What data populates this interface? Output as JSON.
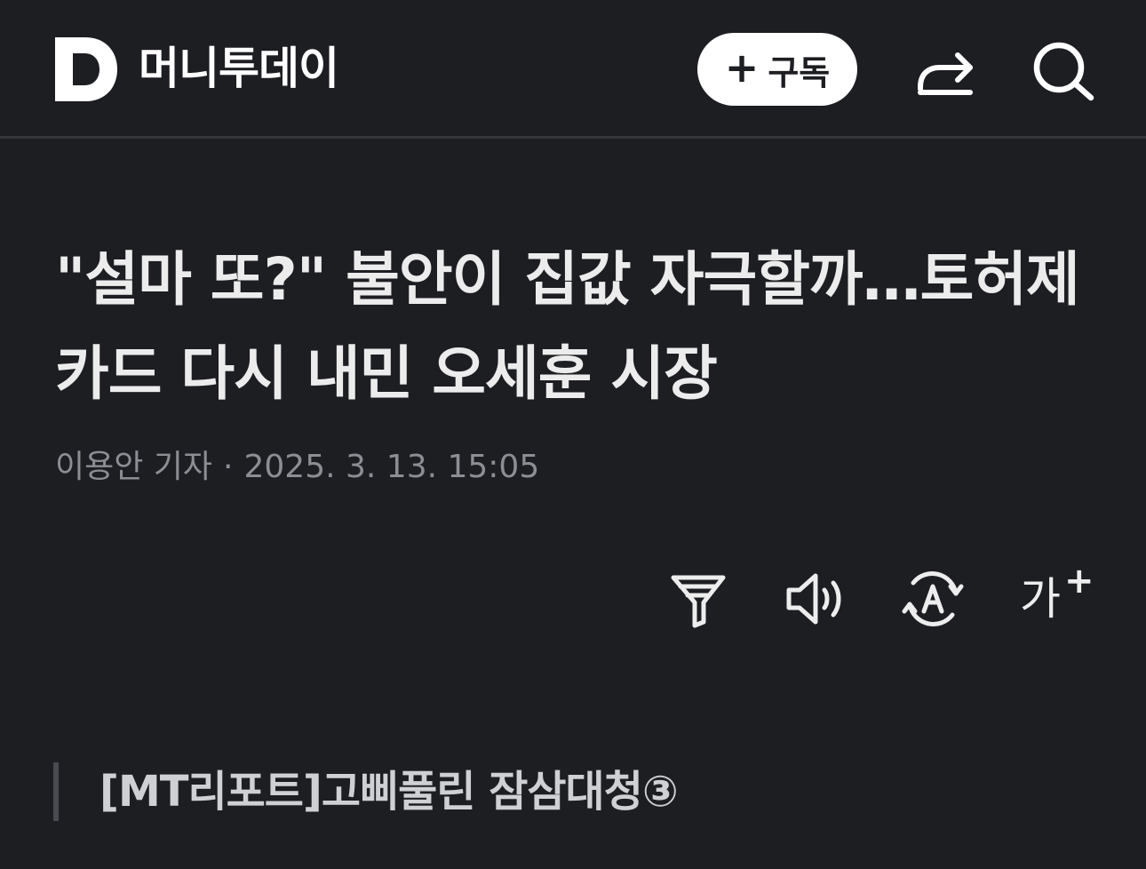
{
  "header": {
    "logo_letter": "D",
    "brand_name": "머니투데이",
    "subscribe_plus": "+",
    "subscribe_label": "구독"
  },
  "article": {
    "headline": "\"설마 또?\" 불안이 집값 자극할까…토허제 카드 다시 내민 오세훈 시장",
    "author": "이용안 기자",
    "separator": "·",
    "date": "2025. 3. 13. 15:05"
  },
  "tools": {
    "font_size_label": "가",
    "font_size_plus": "+"
  },
  "summary": {
    "text": "[MT리포트]고삐풀린 잠삼대청③"
  },
  "icons": {
    "share": "share-icon",
    "search": "search-icon",
    "filter": "filter-icon",
    "audio": "speaker-icon",
    "translate": "translate-icon"
  },
  "colors": {
    "background": "#1d1e22",
    "text": "#ececec",
    "muted": "#8d8e93",
    "button_bg": "#ffffff"
  }
}
